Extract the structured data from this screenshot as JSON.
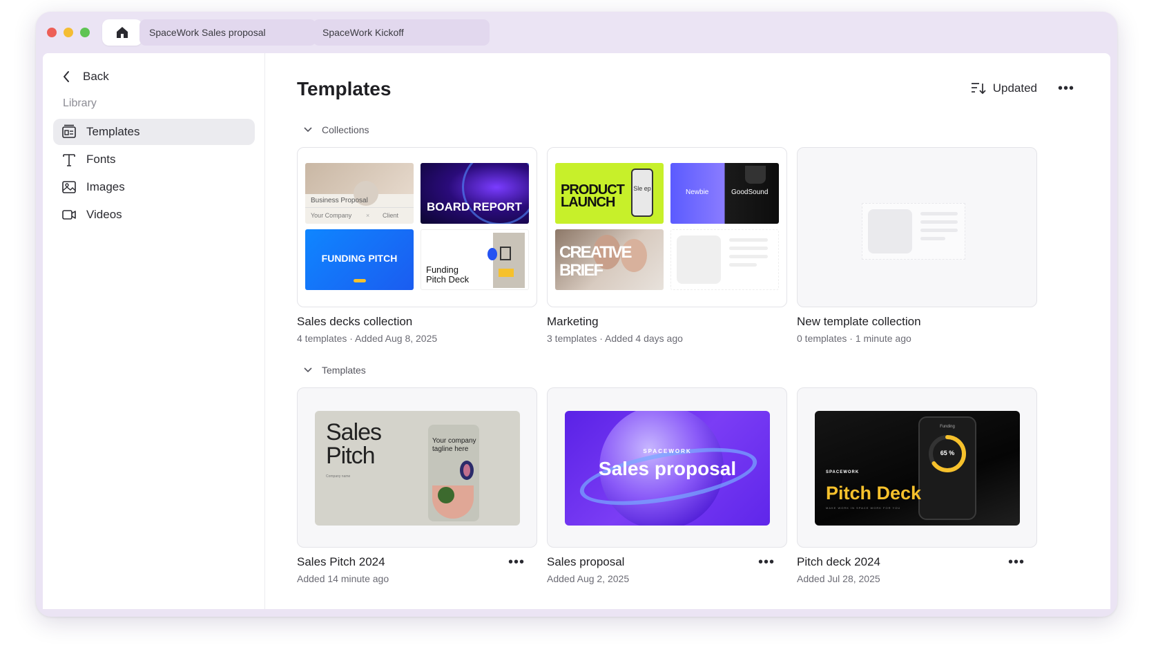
{
  "tabs": [
    {
      "label": "SpaceWork Sales proposal"
    },
    {
      "label": "SpaceWork Kickoff"
    }
  ],
  "sidebar": {
    "back_label": "Back",
    "section_label": "Library",
    "items": [
      {
        "label": "Templates",
        "icon": "templates-icon",
        "active": true
      },
      {
        "label": "Fonts",
        "icon": "font-icon"
      },
      {
        "label": "Images",
        "icon": "image-icon"
      },
      {
        "label": "Videos",
        "icon": "video-icon"
      }
    ]
  },
  "main": {
    "title": "Templates",
    "sort_label": "Updated",
    "collections_heading": "Collections",
    "templates_heading": "Templates",
    "collections": [
      {
        "title": "Sales decks collection",
        "count": "4 templates",
        "separator": " · ",
        "added": "Added Aug 8, 2025",
        "thumbs": {
          "business_proposal": {
            "title": "Business Proposal",
            "company": "Your Company",
            "x": "×",
            "client": "Client"
          },
          "board_report": "BOARD REPORT",
          "funding_pitch": "FUNDING PITCH",
          "funding_deck": {
            "line1": "Funding",
            "line2": "Pitch Deck"
          }
        }
      },
      {
        "title": "Marketing",
        "count": "3 templates",
        "separator": " · ",
        "added": "Added 4 days ago",
        "thumbs": {
          "product_launch": {
            "line1": "PRODUCT",
            "line2": "LAUNCH",
            "phone_text": "Sle ep"
          },
          "newbie": {
            "left": "Newbie",
            "right": "GoodSound"
          },
          "creative_brief": {
            "line1": "CREATIVE",
            "line2": "BRIEF"
          }
        }
      },
      {
        "title": "New template collection",
        "count": "0 templates",
        "separator": " · ",
        "added": "1 minute ago"
      }
    ],
    "templates": [
      {
        "title": "Sales Pitch 2024",
        "added": "Added 14 minute ago",
        "thumb": {
          "line1": "Sales",
          "line2": "Pitch",
          "tagline": "Your company tagline here",
          "company": "Company name"
        }
      },
      {
        "title": "Sales proposal",
        "added": "Added Aug 2, 2025",
        "thumb": {
          "brand": "SPACEWORK",
          "text": "Sales proposal"
        }
      },
      {
        "title": "Pitch deck 2024",
        "added": "Added Jul 28, 2025",
        "thumb": {
          "brand": "SPACEWORK",
          "text": "Pitch Deck",
          "funding": "Funding",
          "percent": "65 %",
          "progress": 0.65,
          "subtitle": "MAKE WORK IN SPACE WORK FOR YOU"
        }
      }
    ]
  },
  "colors": {
    "window_frame": "#ebe4f4",
    "tab_bg": "#e2d8ee",
    "active_nav": "#ebebef",
    "accent_yellow": "#f6c12c",
    "accent_purple": "#6a2cf0"
  }
}
